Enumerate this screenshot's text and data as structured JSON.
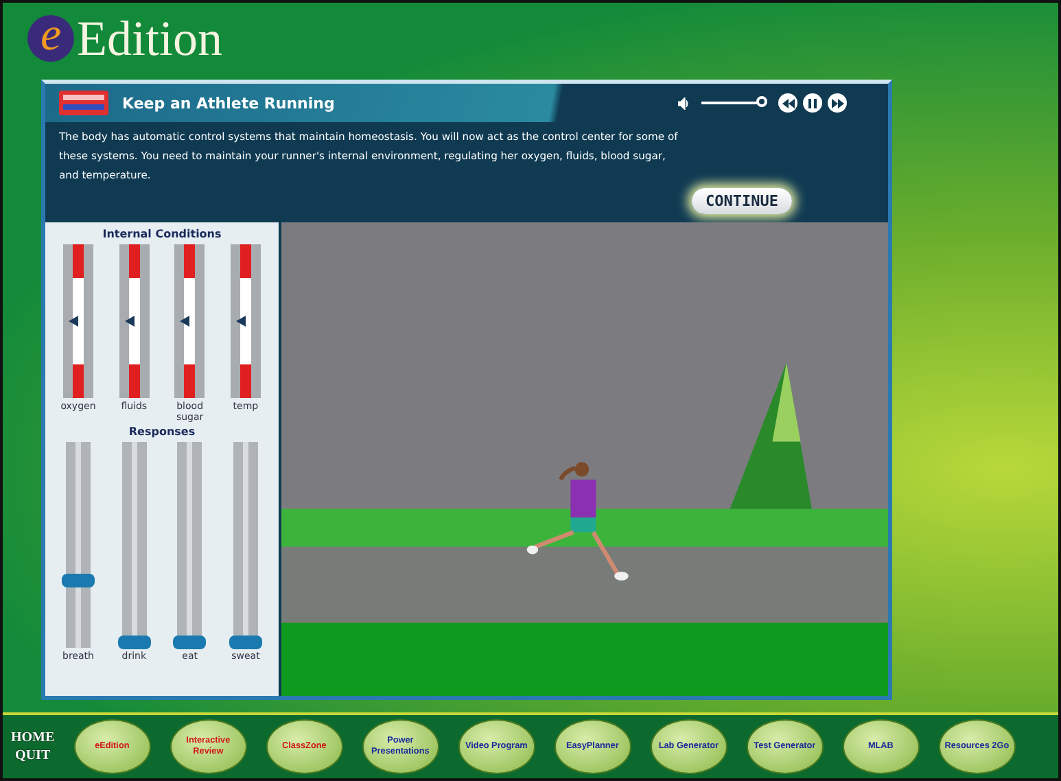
{
  "header": {
    "logo_letter": "e",
    "title": "Edition"
  },
  "activity": {
    "title": "Keep an Athlete Running",
    "volume": {
      "level": 1
    },
    "description": "The body has automatic control systems that maintain homeostasis. You will now act as the control center for some of these systems. You need to maintain your runner's internal environment, regulating her oxygen, fluids, blood sugar, and temperature.",
    "continue_button": "CONTINUE"
  },
  "conditions": {
    "title": "Internal Conditions",
    "gauges": [
      {
        "label": "oxygen",
        "level": 0.5
      },
      {
        "label": "fluids",
        "level": 0.5
      },
      {
        "label": "blood sugar",
        "level": 0.5
      },
      {
        "label": "temp",
        "level": 0.5
      }
    ]
  },
  "responses": {
    "title": "Responses",
    "sliders": [
      {
        "label": "breath",
        "level": 0.3
      },
      {
        "label": "drink",
        "level": 0
      },
      {
        "label": "eat",
        "level": 0
      },
      {
        "label": "sweat",
        "level": 0
      }
    ]
  },
  "nav": {
    "home": "HOME",
    "quit": "QUIT",
    "buttons": [
      {
        "label": "eEdition",
        "kind": "student"
      },
      {
        "label": "Interactive Review",
        "kind": "student"
      },
      {
        "label": "ClassZone",
        "kind": "student"
      },
      {
        "label": "Power Presentations",
        "kind": "teacher"
      },
      {
        "label": "Video Program",
        "kind": "teacher"
      },
      {
        "label": "EasyPlanner",
        "kind": "teacher"
      },
      {
        "label": "Lab Generator",
        "kind": "teacher"
      },
      {
        "label": "Test Generator",
        "kind": "teacher"
      },
      {
        "label": "MLAB",
        "kind": "teacher"
      },
      {
        "label": "Resources 2Go",
        "kind": "teacher"
      }
    ]
  }
}
